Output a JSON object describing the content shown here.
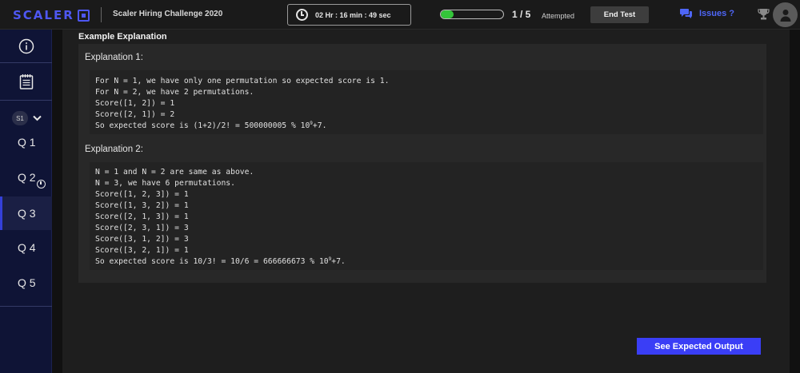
{
  "header": {
    "logo_text": "SCALER",
    "challenge_title": "Scaler Hiring Challenge 2020",
    "timer_text": "02 Hr : 16 min : 49 sec",
    "progress_fraction": 0.2,
    "progress_count": "1 / 5",
    "progress_label": "Attempted",
    "end_test_label": "End Test",
    "issues_label": "Issues ?"
  },
  "sidebar": {
    "section_badge": "S1",
    "questions": [
      {
        "label": "Q 1",
        "active": false
      },
      {
        "label": "Q 2",
        "active": false
      },
      {
        "label": "Q 3",
        "active": true
      },
      {
        "label": "Q 4",
        "active": false
      },
      {
        "label": "Q 5",
        "active": false
      }
    ]
  },
  "content": {
    "section_heading": "Example Explanation",
    "explanation1_label": "Explanation 1:",
    "explanation1_lines": [
      "For N = 1, we have only one permutation so expected score is 1.",
      "For N = 2, we have 2 permutations.",
      "Score([1, 2]) = 1",
      "Score([2, 1]) = 2",
      "So expected score is (1+2)/2! = 500000005 % 10^9+7."
    ],
    "explanation2_label": "Explanation 2:",
    "explanation2_lines": [
      "N = 1 and N = 2 are same as above.",
      "N = 3, we have 6 permutations.",
      "Score([1, 2, 3]) = 1",
      "Score([1, 3, 2]) = 1",
      "Score([2, 1, 3]) = 1",
      "Score([2, 3, 1]) = 3",
      "Score([3, 1, 2]) = 3",
      "Score([3, 2, 1]) = 1",
      "So expected score is 10/3! = 10/6 = 666666673 % 10^9+7."
    ],
    "expected_output_label": "See Expected Output"
  },
  "colors": {
    "accent": "#3a3ef6",
    "brand": "#4e57f2",
    "progress": "#34c53a",
    "sidebar_bg": "#0f1436"
  }
}
